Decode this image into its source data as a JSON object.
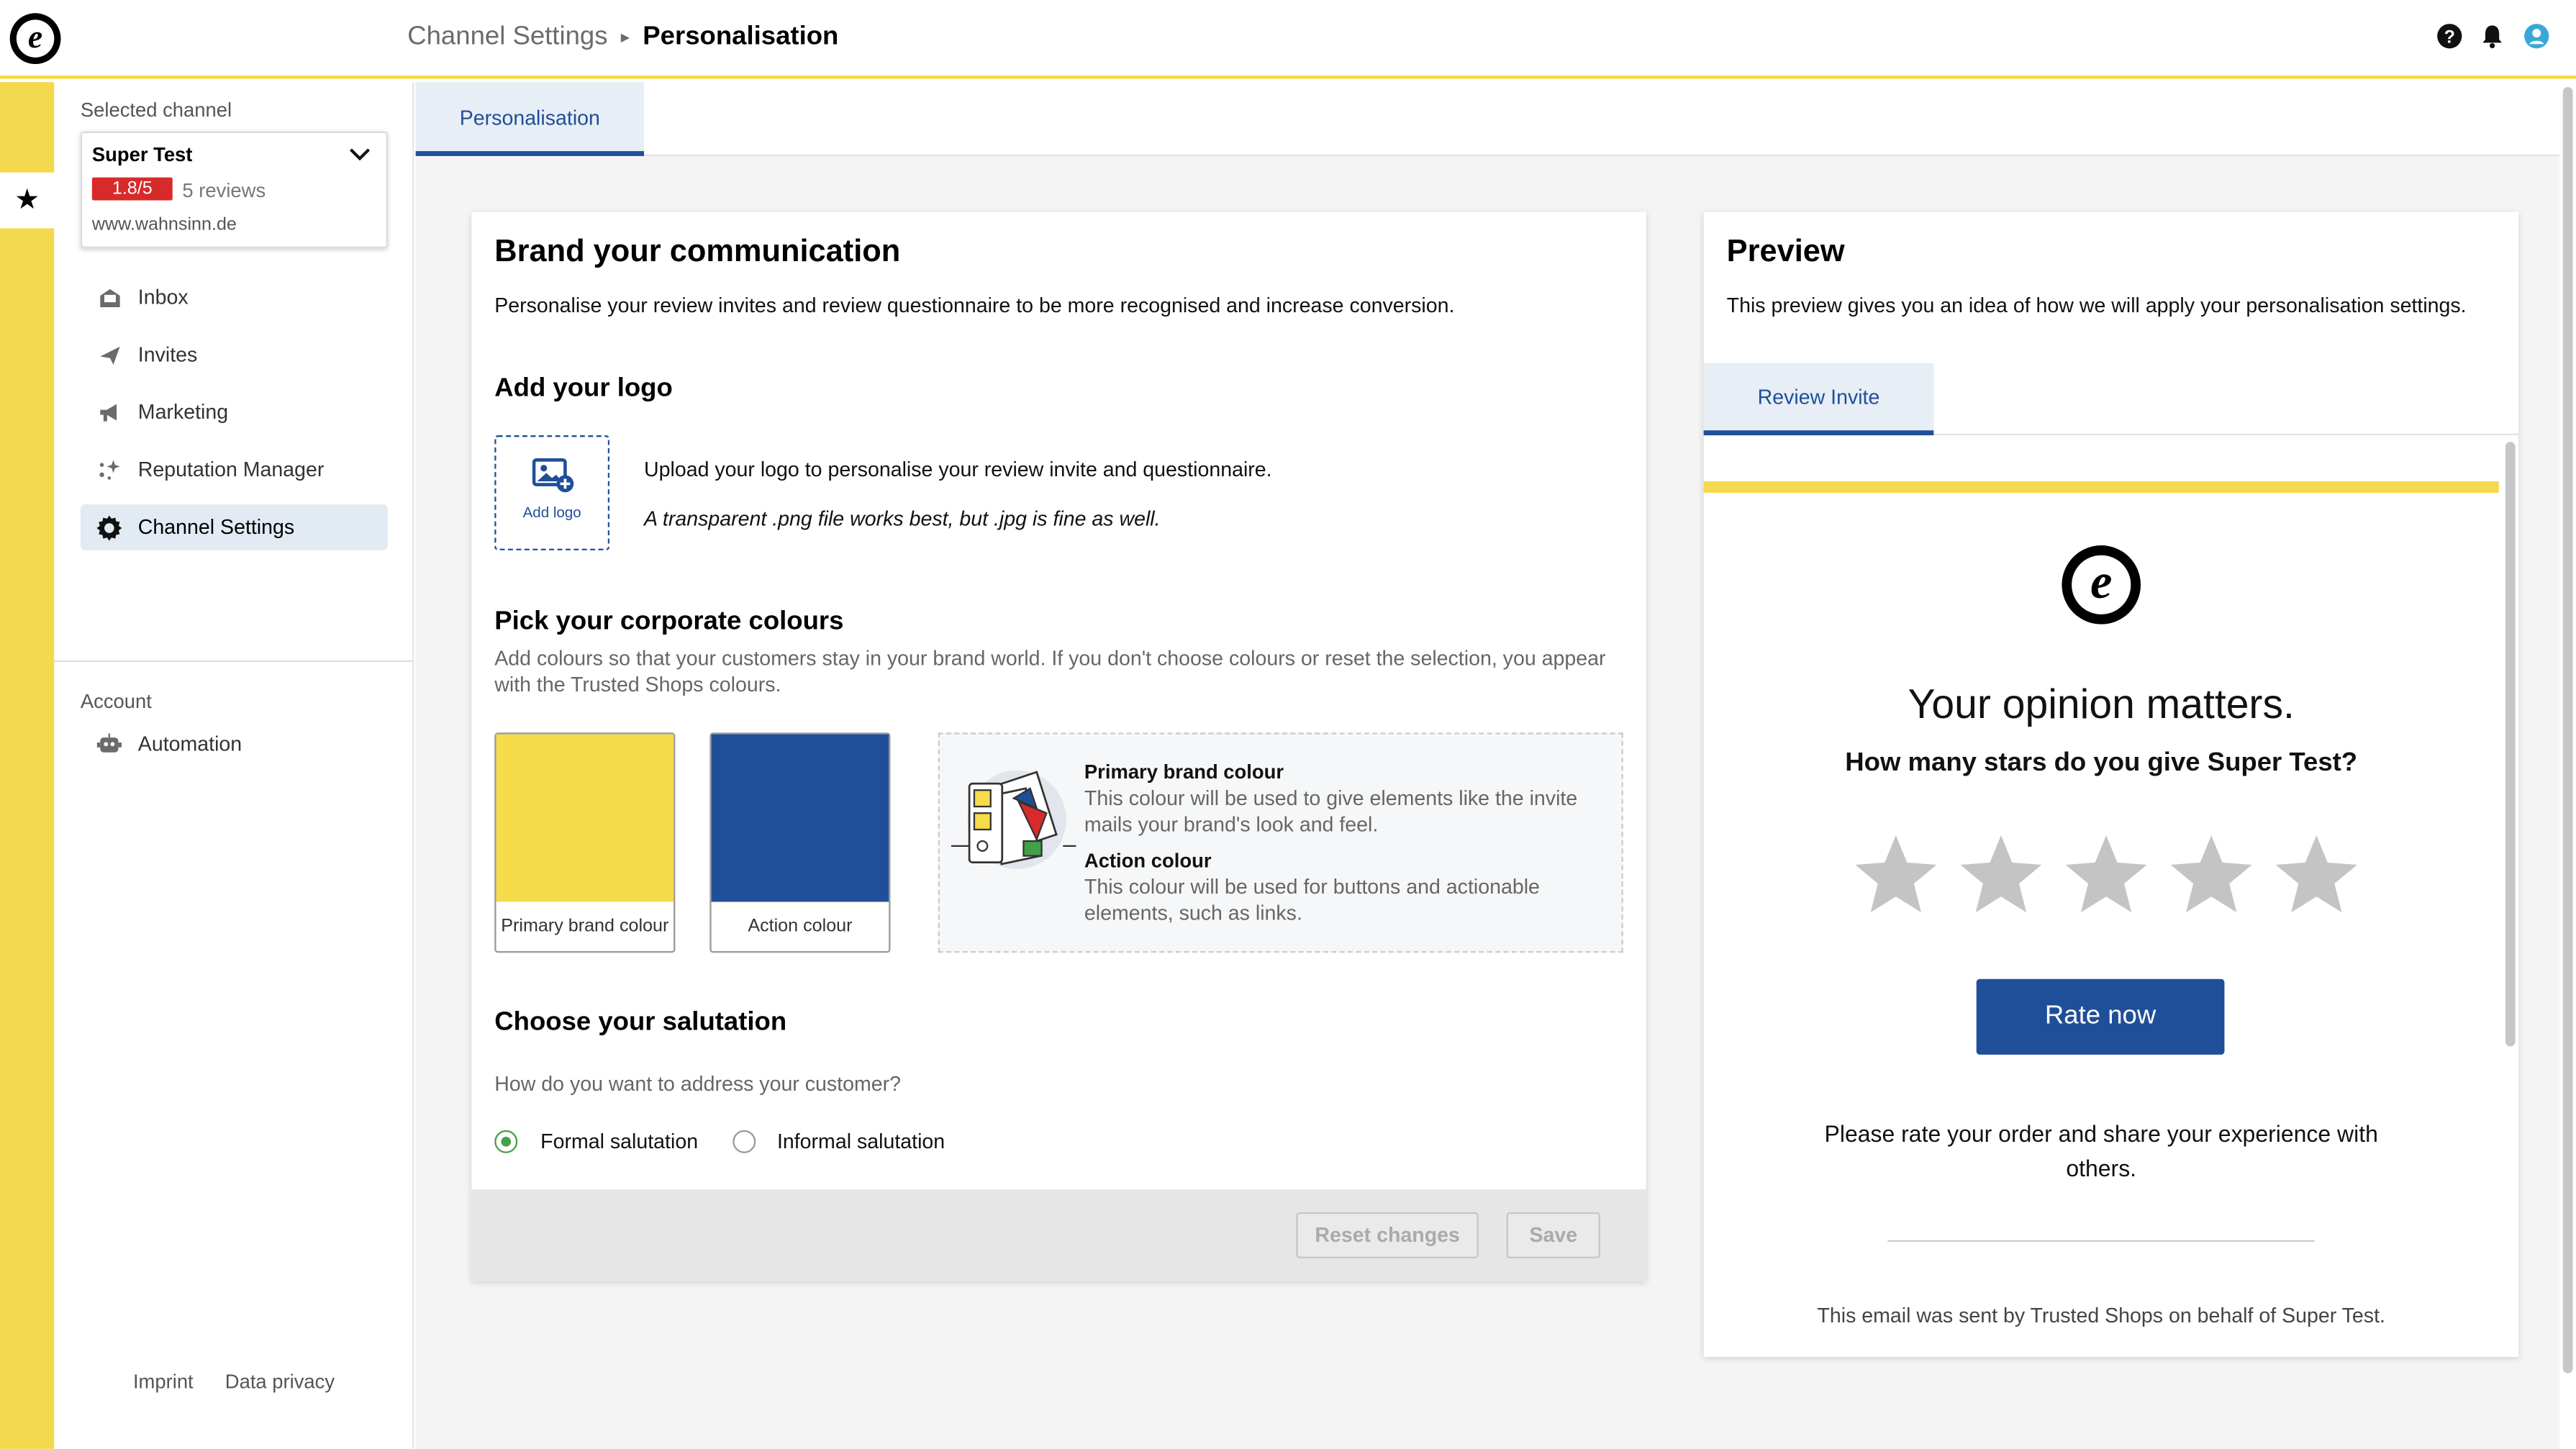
{
  "header": {
    "breadcrumb_parent": "Channel Settings",
    "breadcrumb_current": "Personalisation",
    "logo_letter": "e"
  },
  "colors": {
    "brand_yellow": "#f4d94e",
    "action_blue": "#1f4f98",
    "rating_red": "#d82a2a",
    "radio_green": "#44a047"
  },
  "sidebar": {
    "selected_channel_label": "Selected channel",
    "channel": {
      "name": "Super Test",
      "rating": "1.8/5",
      "reviews": "5 reviews",
      "url": "www.wahnsinn.de"
    },
    "items": [
      {
        "label": "Inbox",
        "icon": "inbox-icon"
      },
      {
        "label": "Invites",
        "icon": "send-icon"
      },
      {
        "label": "Marketing",
        "icon": "megaphone-icon"
      },
      {
        "label": "Reputation Manager",
        "icon": "sparkle-icon"
      },
      {
        "label": "Channel Settings",
        "icon": "gear-icon"
      }
    ],
    "account_label": "Account",
    "account_items": [
      {
        "label": "Automation",
        "icon": "robot-icon"
      }
    ],
    "footer": {
      "imprint": "Imprint",
      "privacy": "Data privacy"
    }
  },
  "main": {
    "tab": "Personalisation",
    "brand": {
      "title": "Brand your communication",
      "intro": "Personalise your review invites and review questionnaire to be more recognised and increase conversion.",
      "logo_title": "Add your logo",
      "add_logo": "Add logo",
      "logo_desc": "Upload your logo to personalise your review invite and questionnaire.",
      "logo_hint": "A transparent .png file works best, but .jpg is fine as well.",
      "colours_title": "Pick your corporate colours",
      "colours_desc": "Add colours so that your customers stay in your brand world. If you don't choose colours or reset the selection, you appear with the Trusted Shops colours.",
      "primary_swatch_label": "Primary brand colour",
      "action_swatch_label": "Action colour",
      "info_primary_title": "Primary brand colour",
      "info_primary_desc": "This colour will be used to give elements like the invite mails your brand's look and feel.",
      "info_action_title": "Action colour",
      "info_action_desc": "This colour will be used for buttons and actionable elements, such as links.",
      "salutation_title": "Choose your salutation",
      "salutation_question": "How do you want to address your customer?",
      "formal": "Formal salutation",
      "informal": "Informal salutation",
      "selected_salutation": "Formal salutation",
      "reset_btn": "Reset changes",
      "save_btn": "Save"
    },
    "preview": {
      "title": "Preview",
      "desc": "This preview gives you an idea of how we will apply your personalisation settings.",
      "tab": "Review Invite",
      "logo_letter": "e",
      "headline": "Your opinion matters.",
      "question": "How many stars do you give Super Test?",
      "stars_count": 5,
      "rate_btn": "Rate now",
      "body_text": "Please rate your order and share your experience with others.",
      "footer_text": "This email was sent by Trusted Shops on behalf of Super Test."
    }
  }
}
